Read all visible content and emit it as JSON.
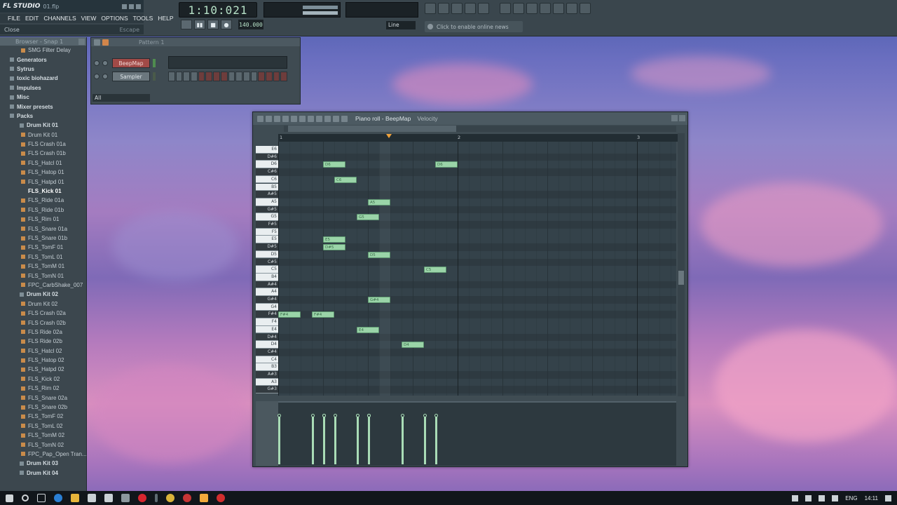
{
  "app": {
    "logo": "FL STUDIO",
    "file": "01.flp"
  },
  "menu": [
    "FILE",
    "EDIT",
    "CHANNELS",
    "VIEW",
    "OPTIONS",
    "TOOLS",
    "HELP"
  ],
  "hint": {
    "text": "Close",
    "key": "Escape"
  },
  "transport": {
    "time": "1:10:021",
    "tempo": "140.000",
    "snap": "Line"
  },
  "news": {
    "text": "Click to enable online news"
  },
  "browser": {
    "title": "Browser - Snap 1",
    "items": [
      {
        "label": "SMG Filter Delay",
        "kind": "file"
      },
      {
        "label": "Generators",
        "kind": "folder"
      },
      {
        "label": "Sytrus",
        "kind": "folder"
      },
      {
        "label": "toxic biohazard",
        "kind": "folder"
      },
      {
        "label": "Impulses",
        "kind": "folder"
      },
      {
        "label": "Misc",
        "kind": "folder"
      },
      {
        "label": "Mixer presets",
        "kind": "folder"
      },
      {
        "label": "Packs",
        "kind": "folder"
      },
      {
        "label": "Drum Kit 01",
        "kind": "folder"
      },
      {
        "label": "Drum Kit 01",
        "kind": "file"
      },
      {
        "label": "FLS Crash 01a",
        "kind": "file"
      },
      {
        "label": "FLS Crash 01b",
        "kind": "file"
      },
      {
        "label": "FLS_Hatcl 01",
        "kind": "file"
      },
      {
        "label": "FLS_Hatop 01",
        "kind": "file"
      },
      {
        "label": "FLS_Hatpd 01",
        "kind": "file"
      },
      {
        "label": "FLS_Kick 01",
        "kind": "selected"
      },
      {
        "label": "FLS_Ride 01a",
        "kind": "file"
      },
      {
        "label": "FLS_Ride 01b",
        "kind": "file"
      },
      {
        "label": "FLS_Rim 01",
        "kind": "file"
      },
      {
        "label": "FLS_Snare 01a",
        "kind": "file"
      },
      {
        "label": "FLS_Snare 01b",
        "kind": "file"
      },
      {
        "label": "FLS_TomF 01",
        "kind": "file"
      },
      {
        "label": "FLS_TomL 01",
        "kind": "file"
      },
      {
        "label": "FLS_TomM 01",
        "kind": "file"
      },
      {
        "label": "FLS_TomN 01",
        "kind": "file"
      },
      {
        "label": "FPC_CarbShake_007",
        "kind": "file"
      },
      {
        "label": "Drum Kit 02",
        "kind": "folder"
      },
      {
        "label": "Drum Kit 02",
        "kind": "file"
      },
      {
        "label": "FLS Crash 02a",
        "kind": "file"
      },
      {
        "label": "FLS Crash 02b",
        "kind": "file"
      },
      {
        "label": "FLS Ride 02a",
        "kind": "file"
      },
      {
        "label": "FLS Ride 02b",
        "kind": "file"
      },
      {
        "label": "FLS_Hatcl 02",
        "kind": "file"
      },
      {
        "label": "FLS_Hatop 02",
        "kind": "file"
      },
      {
        "label": "FLS_Hatpd 02",
        "kind": "file"
      },
      {
        "label": "FLS_Kick 02",
        "kind": "file"
      },
      {
        "label": "FLS_Rim 02",
        "kind": "file"
      },
      {
        "label": "FLS_Snare 02a",
        "kind": "file"
      },
      {
        "label": "FLS_Snare 02b",
        "kind": "file"
      },
      {
        "label": "FLS_TomF 02",
        "kind": "file"
      },
      {
        "label": "FLS_TomL 02",
        "kind": "file"
      },
      {
        "label": "FLS_TomM 02",
        "kind": "file"
      },
      {
        "label": "FLS_TomN 02",
        "kind": "file"
      },
      {
        "label": "FPC_Pap_Open Tran...",
        "kind": "file"
      },
      {
        "label": "Drum Kit 03",
        "kind": "folder"
      },
      {
        "label": "Drum Kit 04",
        "kind": "folder"
      }
    ]
  },
  "rack": {
    "pattern": "Pattern 1",
    "channels": [
      "BeepMap",
      "Sampler"
    ],
    "filter": "All"
  },
  "pianoroll": {
    "title": "Piano roll - BeepMap",
    "param": "Velocity",
    "bar_labels": [
      "1",
      "2",
      "3"
    ],
    "keys": [
      "E6",
      "D#6",
      "D6",
      "C#6",
      "C6",
      "B5",
      "A#5",
      "A5",
      "G#5",
      "G5",
      "F#5",
      "F5",
      "E5",
      "D#5",
      "D5",
      "C#5",
      "C5",
      "B4",
      "A#4",
      "A4",
      "G#4",
      "G4",
      "F#4",
      "F4",
      "E4",
      "D#4",
      "D4",
      "C#4",
      "C4",
      "B3",
      "A#3",
      "A3",
      "G#3"
    ],
    "notes": [
      {
        "key": "D6",
        "start": 4,
        "len": 2,
        "label": "D6"
      },
      {
        "key": "C6",
        "start": 5,
        "len": 2,
        "label": "C6"
      },
      {
        "key": "A5",
        "start": 8,
        "len": 2,
        "label": "A5"
      },
      {
        "key": "G5",
        "start": 7,
        "len": 2,
        "label": "G5"
      },
      {
        "key": "E5",
        "start": 4,
        "len": 2,
        "label": "E5"
      },
      {
        "key": "D#5",
        "start": 4,
        "len": 2,
        "label": "D#5"
      },
      {
        "key": "D5",
        "start": 8,
        "len": 2,
        "label": "D5"
      },
      {
        "key": "C5",
        "start": 13,
        "len": 2,
        "label": "C5"
      },
      {
        "key": "G#4",
        "start": 8,
        "len": 2,
        "label": "G#4"
      },
      {
        "key": "F#4",
        "start": 0,
        "len": 2,
        "label": "F#4"
      },
      {
        "key": "F#4",
        "start": 3,
        "len": 2,
        "label": "F#4"
      },
      {
        "key": "E4",
        "start": 7,
        "len": 2,
        "label": "E4"
      },
      {
        "key": "D4",
        "start": 11,
        "len": 2,
        "label": "D4"
      },
      {
        "key": "D6",
        "start": 14,
        "len": 2,
        "label": "D6"
      }
    ]
  },
  "taskbar": {
    "lang": "ENG",
    "time": "14:11"
  }
}
